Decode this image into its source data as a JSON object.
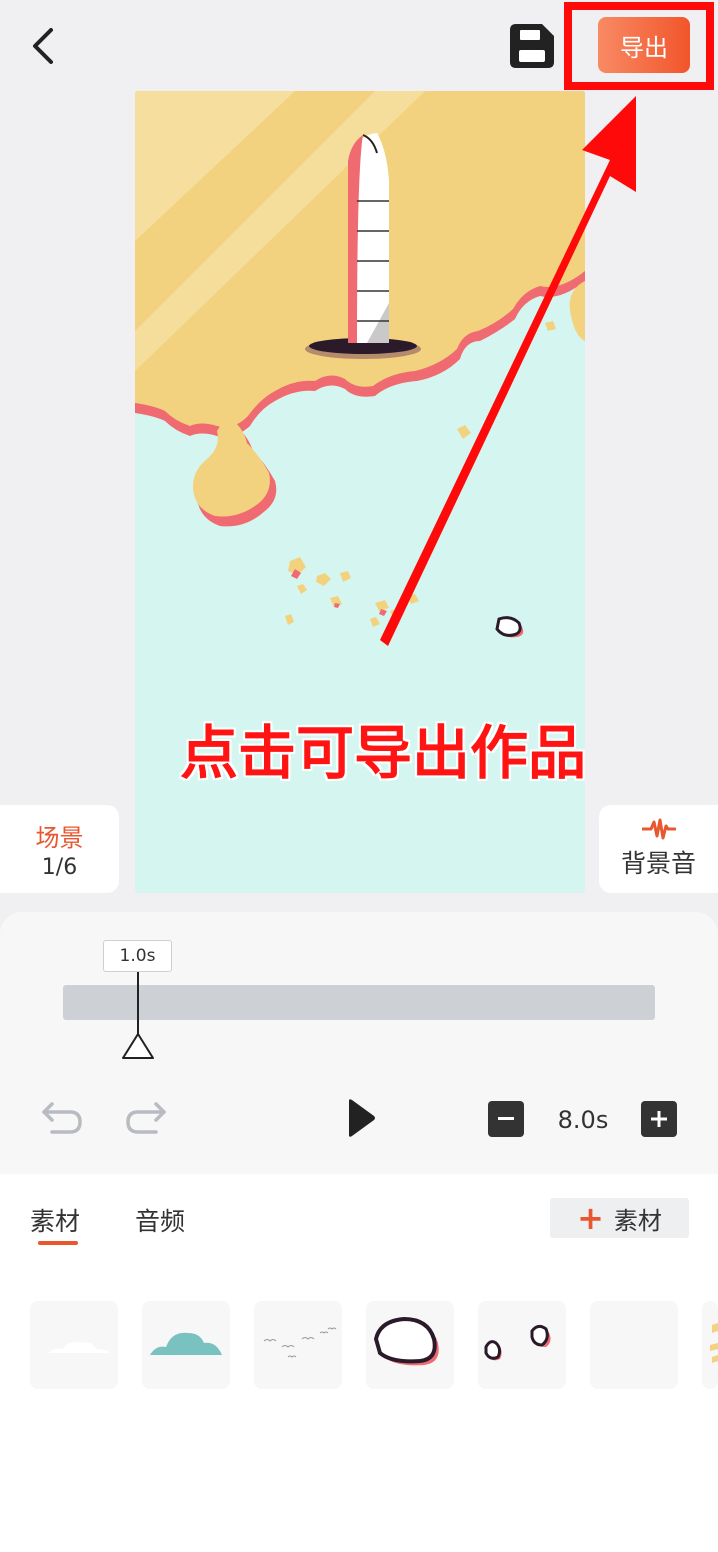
{
  "topbar": {
    "back_icon": "chevron-left-icon",
    "save_icon": "save-floppy-icon",
    "export_label": "导出"
  },
  "scene": {
    "label": "场景",
    "count": "1/6"
  },
  "music": {
    "icon": "waveform-icon",
    "label": "背景音"
  },
  "timeline": {
    "current_time": "1.0s",
    "duration": "8.0s",
    "playhead_fraction": 0.125
  },
  "bottom": {
    "tabs": [
      {
        "label": "素材",
        "active": true
      },
      {
        "label": "音频",
        "active": false
      }
    ],
    "add_material_label": "素材"
  },
  "annotation": {
    "text": "点击可导出作品"
  },
  "colors": {
    "accent": "#e8572f",
    "highlight": "#ff0a0a",
    "canvas_sea": "#d5f6f0",
    "canvas_land": "#f2d27e",
    "coast": "#ef6b71"
  }
}
